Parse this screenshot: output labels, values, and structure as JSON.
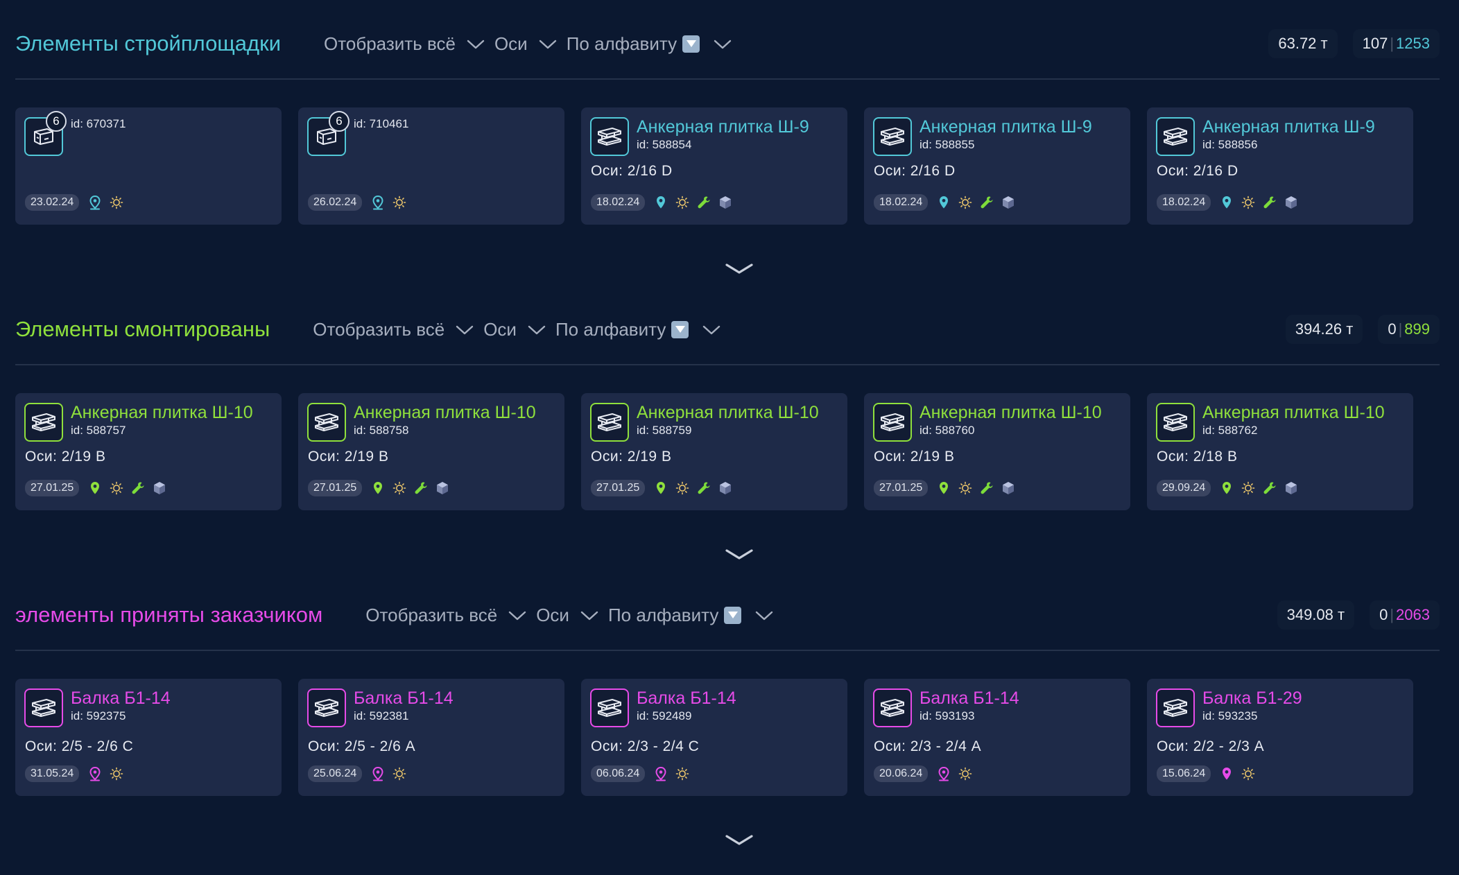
{
  "sections": [
    {
      "title": "Элементы стройплощадки",
      "accent": "#52c8d8",
      "filters": {
        "show_all": "Отобразить всё",
        "axes": "Оси",
        "sort": "По алфавиту"
      },
      "weight": "63.72 т",
      "count_left": "107",
      "count_right": "1253",
      "cards": [
        {
          "title": "",
          "id": "id: 670371",
          "axes": "",
          "date": "23.02.24",
          "badge": "6",
          "icon": "container-icon",
          "icons": [
            "location-outline-icon",
            "sun-icon"
          ]
        },
        {
          "title": "",
          "id": "id: 710461",
          "axes": "",
          "date": "26.02.24",
          "badge": "6",
          "icon": "container-icon",
          "icons": [
            "location-outline-icon",
            "sun-icon"
          ]
        },
        {
          "title": "Анкерная плитка Ш-9",
          "id": "id: 588854",
          "axes": "Оси: 2/16 D",
          "date": "18.02.24",
          "icon": "beam-icon",
          "icons": [
            "location-filled-icon",
            "sun-icon",
            "wrench-icon",
            "cube-icon"
          ]
        },
        {
          "title": "Анкерная плитка Ш-9",
          "id": "id: 588855",
          "axes": "Оси: 2/16 D",
          "date": "18.02.24",
          "icon": "beam-icon",
          "icons": [
            "location-filled-icon",
            "sun-icon",
            "wrench-icon",
            "cube-icon"
          ]
        },
        {
          "title": "Анкерная плитка Ш-9",
          "id": "id: 588856",
          "axes": "Оси: 2/16 D",
          "date": "18.02.24",
          "icon": "beam-icon",
          "icons": [
            "location-filled-icon",
            "sun-icon",
            "wrench-icon",
            "cube-icon"
          ]
        }
      ]
    },
    {
      "title": "Элементы смонтированы",
      "accent": "#8fe03c",
      "filters": {
        "show_all": "Отобразить всё",
        "axes": "Оси",
        "sort": "По алфавиту"
      },
      "weight": "394.26 т",
      "count_left": "0",
      "count_right": "899",
      "cards": [
        {
          "title": "Анкерная плитка Ш-10",
          "id": "id: 588757",
          "axes": "Оси: 2/19 B",
          "date": "27.01.25",
          "icon": "beam-icon",
          "icons": [
            "location-filled-icon",
            "sun-icon",
            "wrench-icon",
            "cube-icon"
          ]
        },
        {
          "title": "Анкерная плитка Ш-10",
          "id": "id: 588758",
          "axes": "Оси: 2/19 B",
          "date": "27.01.25",
          "icon": "beam-icon",
          "icons": [
            "location-filled-icon",
            "sun-icon",
            "wrench-icon",
            "cube-icon"
          ]
        },
        {
          "title": "Анкерная плитка Ш-10",
          "id": "id: 588759",
          "axes": "Оси: 2/19 B",
          "date": "27.01.25",
          "icon": "beam-icon",
          "icons": [
            "location-filled-icon",
            "sun-icon",
            "wrench-icon",
            "cube-icon"
          ]
        },
        {
          "title": "Анкерная плитка Ш-10",
          "id": "id: 588760",
          "axes": "Оси: 2/19 B",
          "date": "27.01.25",
          "icon": "beam-icon",
          "icons": [
            "location-filled-icon",
            "sun-icon",
            "wrench-icon",
            "cube-icon"
          ]
        },
        {
          "title": "Анкерная плитка Ш-10",
          "id": "id: 588762",
          "axes": "Оси: 2/18 B",
          "date": "29.09.24",
          "icon": "beam-icon",
          "icons": [
            "location-filled-icon",
            "sun-icon",
            "wrench-icon",
            "cube-icon"
          ]
        }
      ]
    },
    {
      "title": "элементы приняты заказчиком",
      "accent": "#e64be8",
      "filters": {
        "show_all": "Отобразить всё",
        "axes": "Оси",
        "sort": "По алфавиту"
      },
      "weight": "349.08 т",
      "count_left": "0",
      "count_right": "2063",
      "cards": [
        {
          "title": "Балка Б1-14",
          "id": "id: 592375",
          "axes": "Оси: 2/5 - 2/6 C",
          "date": "31.05.24",
          "icon": "beam-icon",
          "icons": [
            "location-outline-icon",
            "sun-icon"
          ]
        },
        {
          "title": "Балка Б1-14",
          "id": "id: 592381",
          "axes": "Оси: 2/5 - 2/6 A",
          "date": "25.06.24",
          "icon": "beam-icon",
          "icons": [
            "location-outline-icon",
            "sun-icon"
          ]
        },
        {
          "title": "Балка Б1-14",
          "id": "id: 592489",
          "axes": "Оси: 2/3 - 2/4 C",
          "date": "06.06.24",
          "icon": "beam-icon",
          "icons": [
            "location-outline-icon",
            "sun-icon"
          ]
        },
        {
          "title": "Балка Б1-14",
          "id": "id: 593193",
          "axes": "Оси: 2/3 - 2/4 A",
          "date": "20.06.24",
          "icon": "beam-icon",
          "icons": [
            "location-outline-icon",
            "sun-icon"
          ]
        },
        {
          "title": "Балка Б1-29",
          "id": "id: 593235",
          "axes": "Оси: 2/2 - 2/3 A",
          "date": "15.06.24",
          "icon": "beam-icon",
          "icons": [
            "location-filled-icon",
            "sun-icon"
          ]
        }
      ]
    }
  ]
}
